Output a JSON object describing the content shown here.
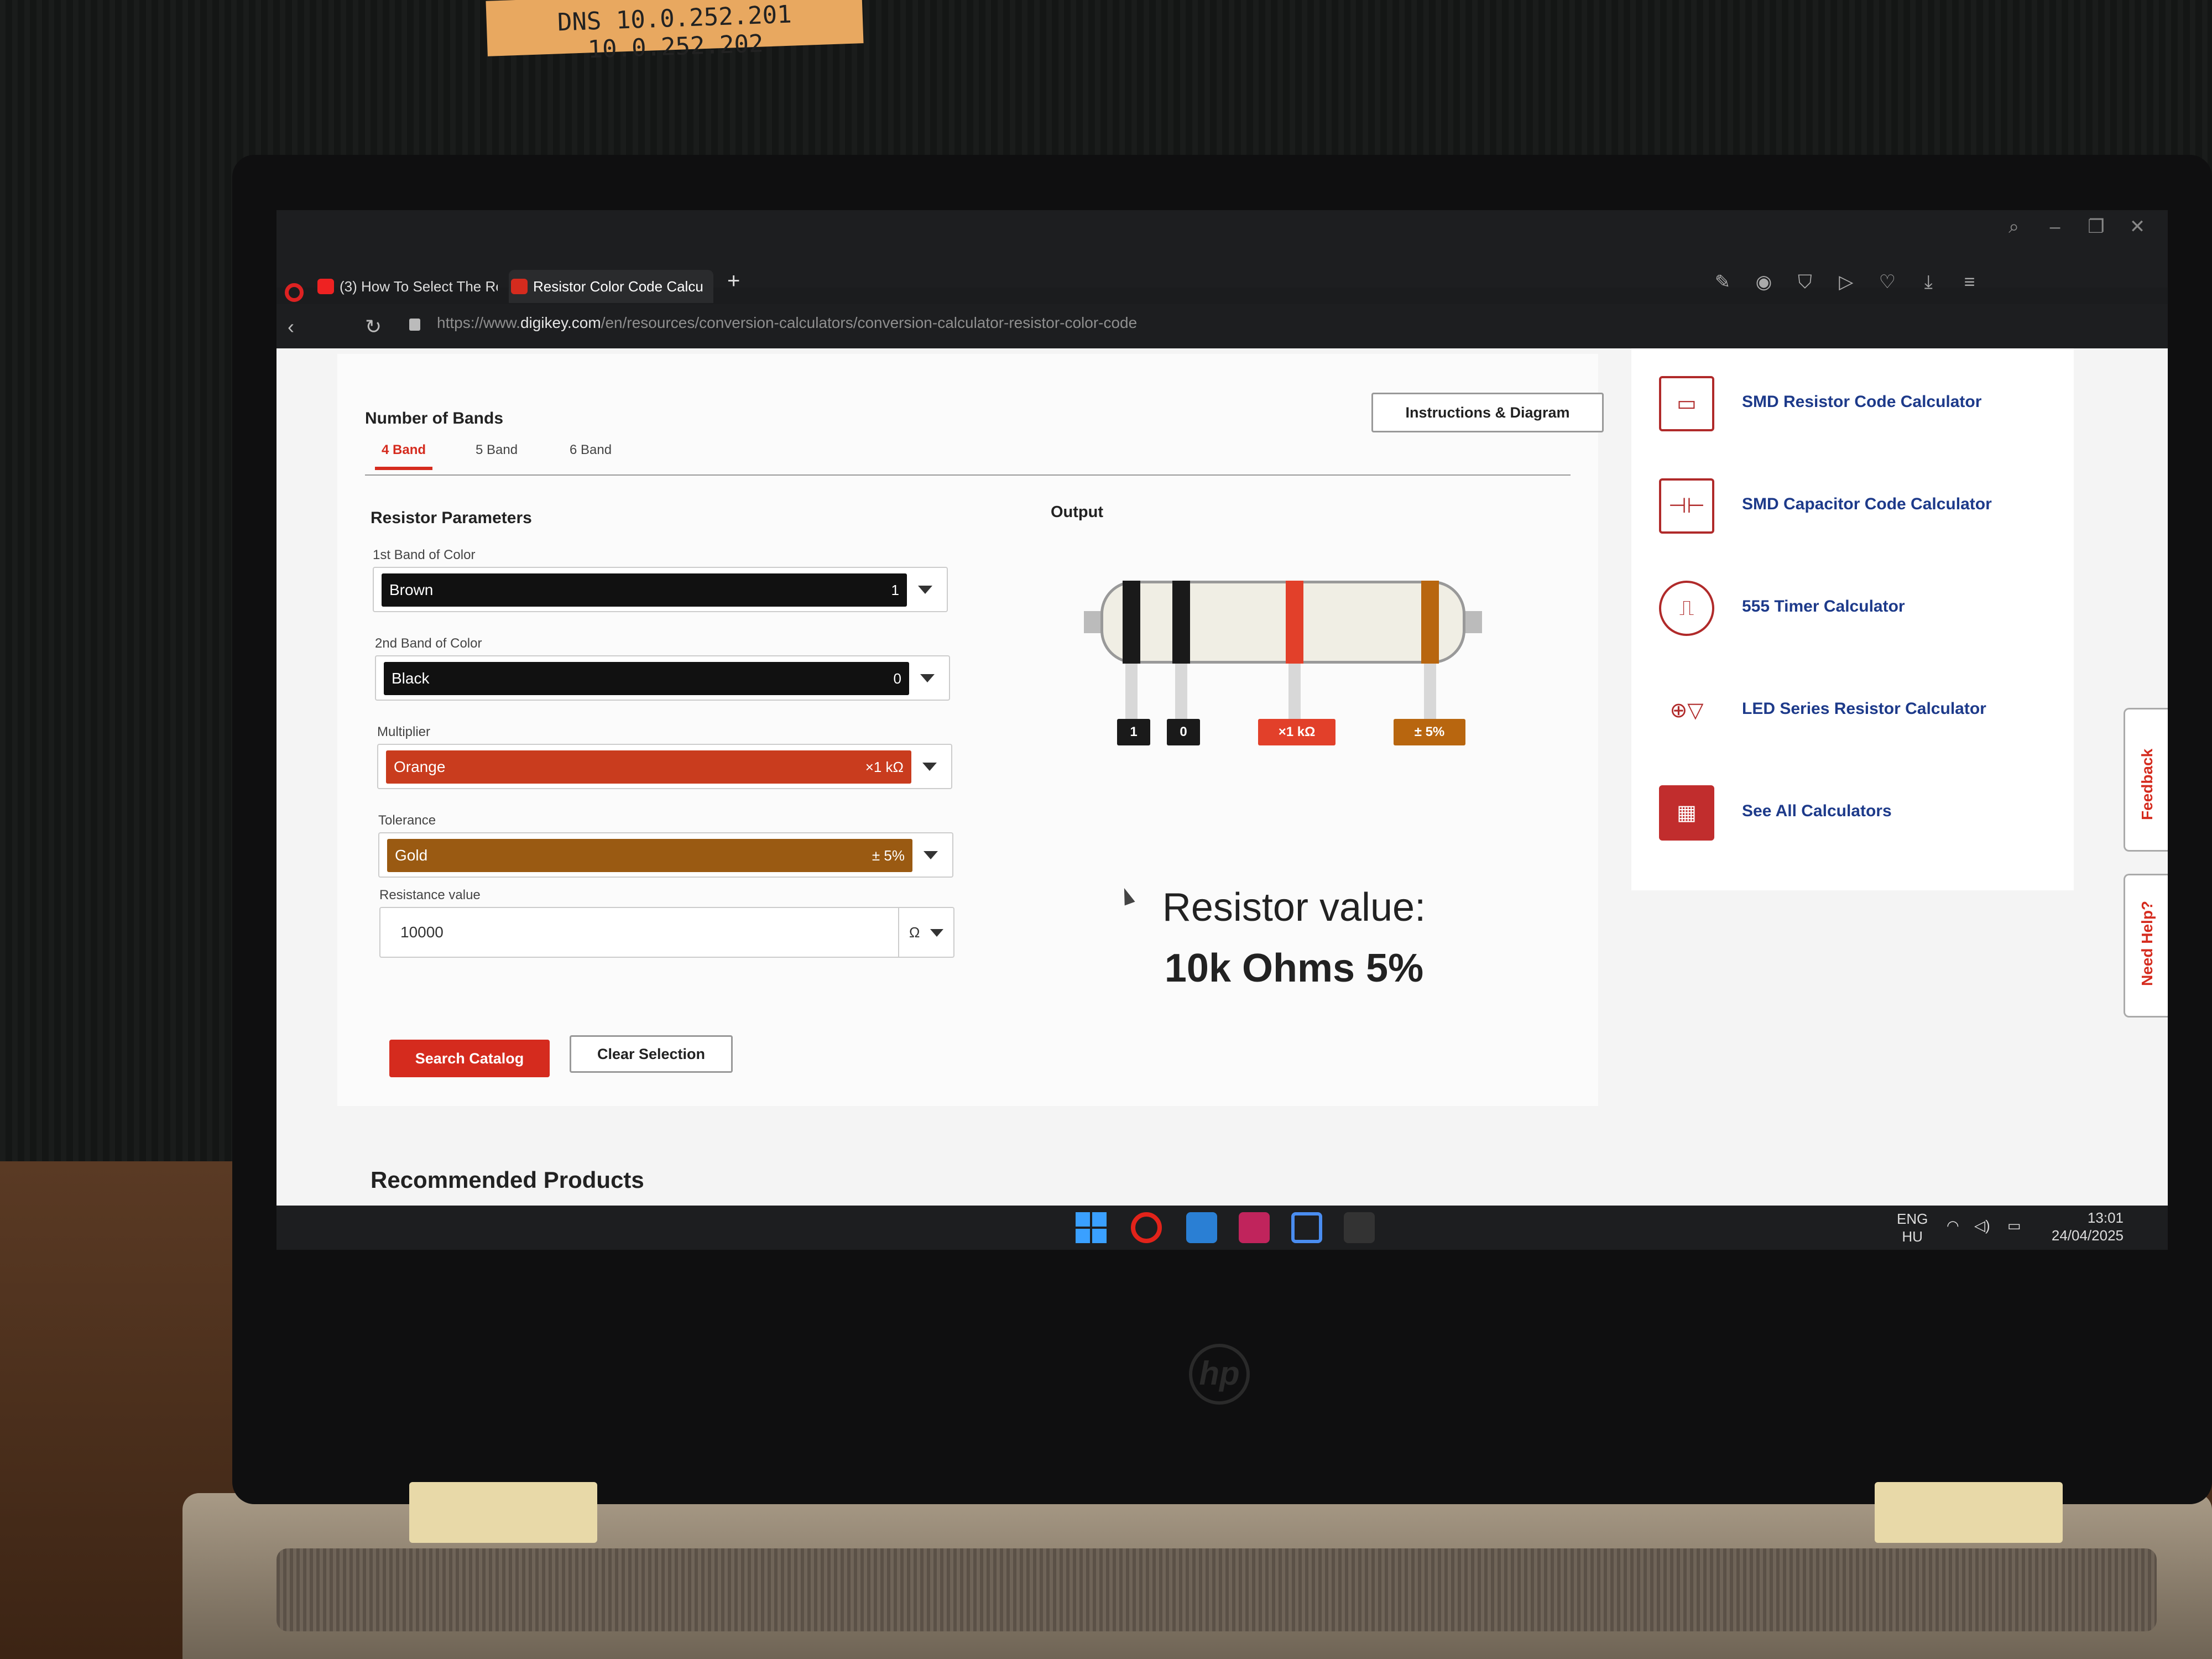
{
  "environment": {
    "sticky_note": "DNS 10.0.252.201 10.0.252.202"
  },
  "browser": {
    "tabs": [
      {
        "label": "(3) How To Select The Re"
      },
      {
        "label": "Resistor Color Code Calcu"
      }
    ],
    "new_tab": "+",
    "url_prefix": "https://www.",
    "url_domain": "digikey.com",
    "url_path": "/en/resources/conversion-calculators/conversion-calculator-resistor-color-code"
  },
  "calculator": {
    "number_of_bands_title": "Number of Bands",
    "band_tabs": [
      "4 Band",
      "5 Band",
      "6 Band"
    ],
    "instructions_button": "Instructions & Diagram",
    "params_title": "Resistor Parameters",
    "fields": [
      {
        "label": "1st Band of Color",
        "value": "Brown",
        "code": "1"
      },
      {
        "label": "2nd Band of Color",
        "value": "Black",
        "code": "0"
      },
      {
        "label": "Multiplier",
        "value": "Orange",
        "code": "×1 kΩ"
      },
      {
        "label": "Tolerance",
        "value": "Gold",
        "code": "± 5%"
      }
    ],
    "resistance": {
      "label": "Resistance value",
      "value": "10000",
      "unit": "Ω"
    },
    "search_button": "Search Catalog",
    "clear_button": "Clear Selection",
    "output_title": "Output",
    "band_tags": [
      "1",
      "0",
      "×1 kΩ",
      "± 5%"
    ],
    "band_colors": [
      "#1a1a1a",
      "#1a1a1a",
      "#e2402a",
      "#b8660f"
    ],
    "result_label": "Resistor value:",
    "result_value": "10k Ohms 5%"
  },
  "sidebar": {
    "items": [
      {
        "label": "SMD Resistor Code Calculator",
        "icon": "smd-resistor-icon"
      },
      {
        "label": "SMD Capacitor Code Calculator",
        "icon": "smd-capacitor-icon"
      },
      {
        "label": "555 Timer Calculator",
        "icon": "timer-icon"
      },
      {
        "label": "LED Series Resistor Calculator",
        "icon": "led-circuit-icon"
      },
      {
        "label": "See All Calculators",
        "icon": "calculator-icon"
      }
    ]
  },
  "side_tabs": {
    "feedback": "Feedback",
    "help": "Need Help?"
  },
  "recommended_title": "Recommended Products",
  "taskbar": {
    "lang_top": "ENG",
    "lang_bottom": "HU",
    "time": "13:01",
    "date": "24/04/2025"
  },
  "colors": {
    "accent": "#d52b1e",
    "link": "#1d3a8a"
  }
}
